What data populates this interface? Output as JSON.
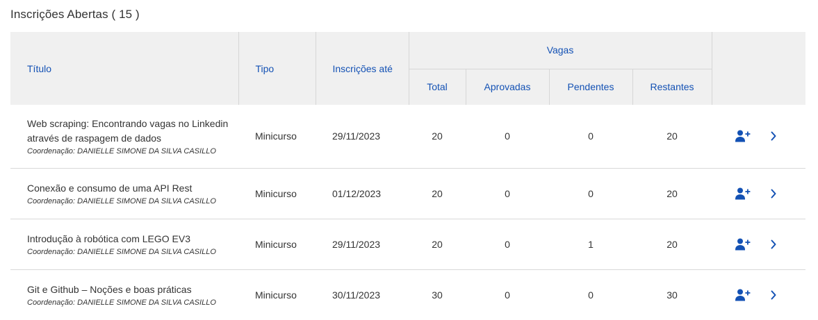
{
  "section": {
    "title": "Inscrições Abertas ( 15 )"
  },
  "table": {
    "headers": {
      "title": "Título",
      "type": "Tipo",
      "deadline": "Inscrições até",
      "vagas": "Vagas",
      "total": "Total",
      "approved": "Aprovadas",
      "pending": "Pendentes",
      "remaining": "Restantes"
    },
    "rows": [
      {
        "title": "Web scraping: Encontrando vagas no Linkedin através de raspagem de dados",
        "coordination": "Coordenação: DANIELLE SIMONE DA SILVA CASILLO",
        "type": "Minicurso",
        "deadline": "29/11/2023",
        "total": "20",
        "approved": "0",
        "pending": "0",
        "remaining": "20"
      },
      {
        "title": "Conexão e consumo de uma API Rest",
        "coordination": "Coordenação: DANIELLE SIMONE DA SILVA CASILLO",
        "type": "Minicurso",
        "deadline": "01/12/2023",
        "total": "20",
        "approved": "0",
        "pending": "0",
        "remaining": "20"
      },
      {
        "title": "Introdução à robótica com LEGO EV3",
        "coordination": "Coordenação: DANIELLE SIMONE DA SILVA CASILLO",
        "type": "Minicurso",
        "deadline": "29/11/2023",
        "total": "20",
        "approved": "0",
        "pending": "1",
        "remaining": "20"
      },
      {
        "title": "Git e Github – Noções e boas práticas",
        "coordination": "Coordenação: DANIELLE SIMONE DA SILVA CASILLO",
        "type": "Minicurso",
        "deadline": "30/11/2023",
        "total": "30",
        "approved": "0",
        "pending": "0",
        "remaining": "30"
      }
    ]
  },
  "icons": {
    "enroll": "user-plus-icon",
    "open": "chevron-right-icon"
  },
  "colors": {
    "accent": "#1351b4",
    "header_bg": "#f0f0f0",
    "text": "#333333"
  }
}
